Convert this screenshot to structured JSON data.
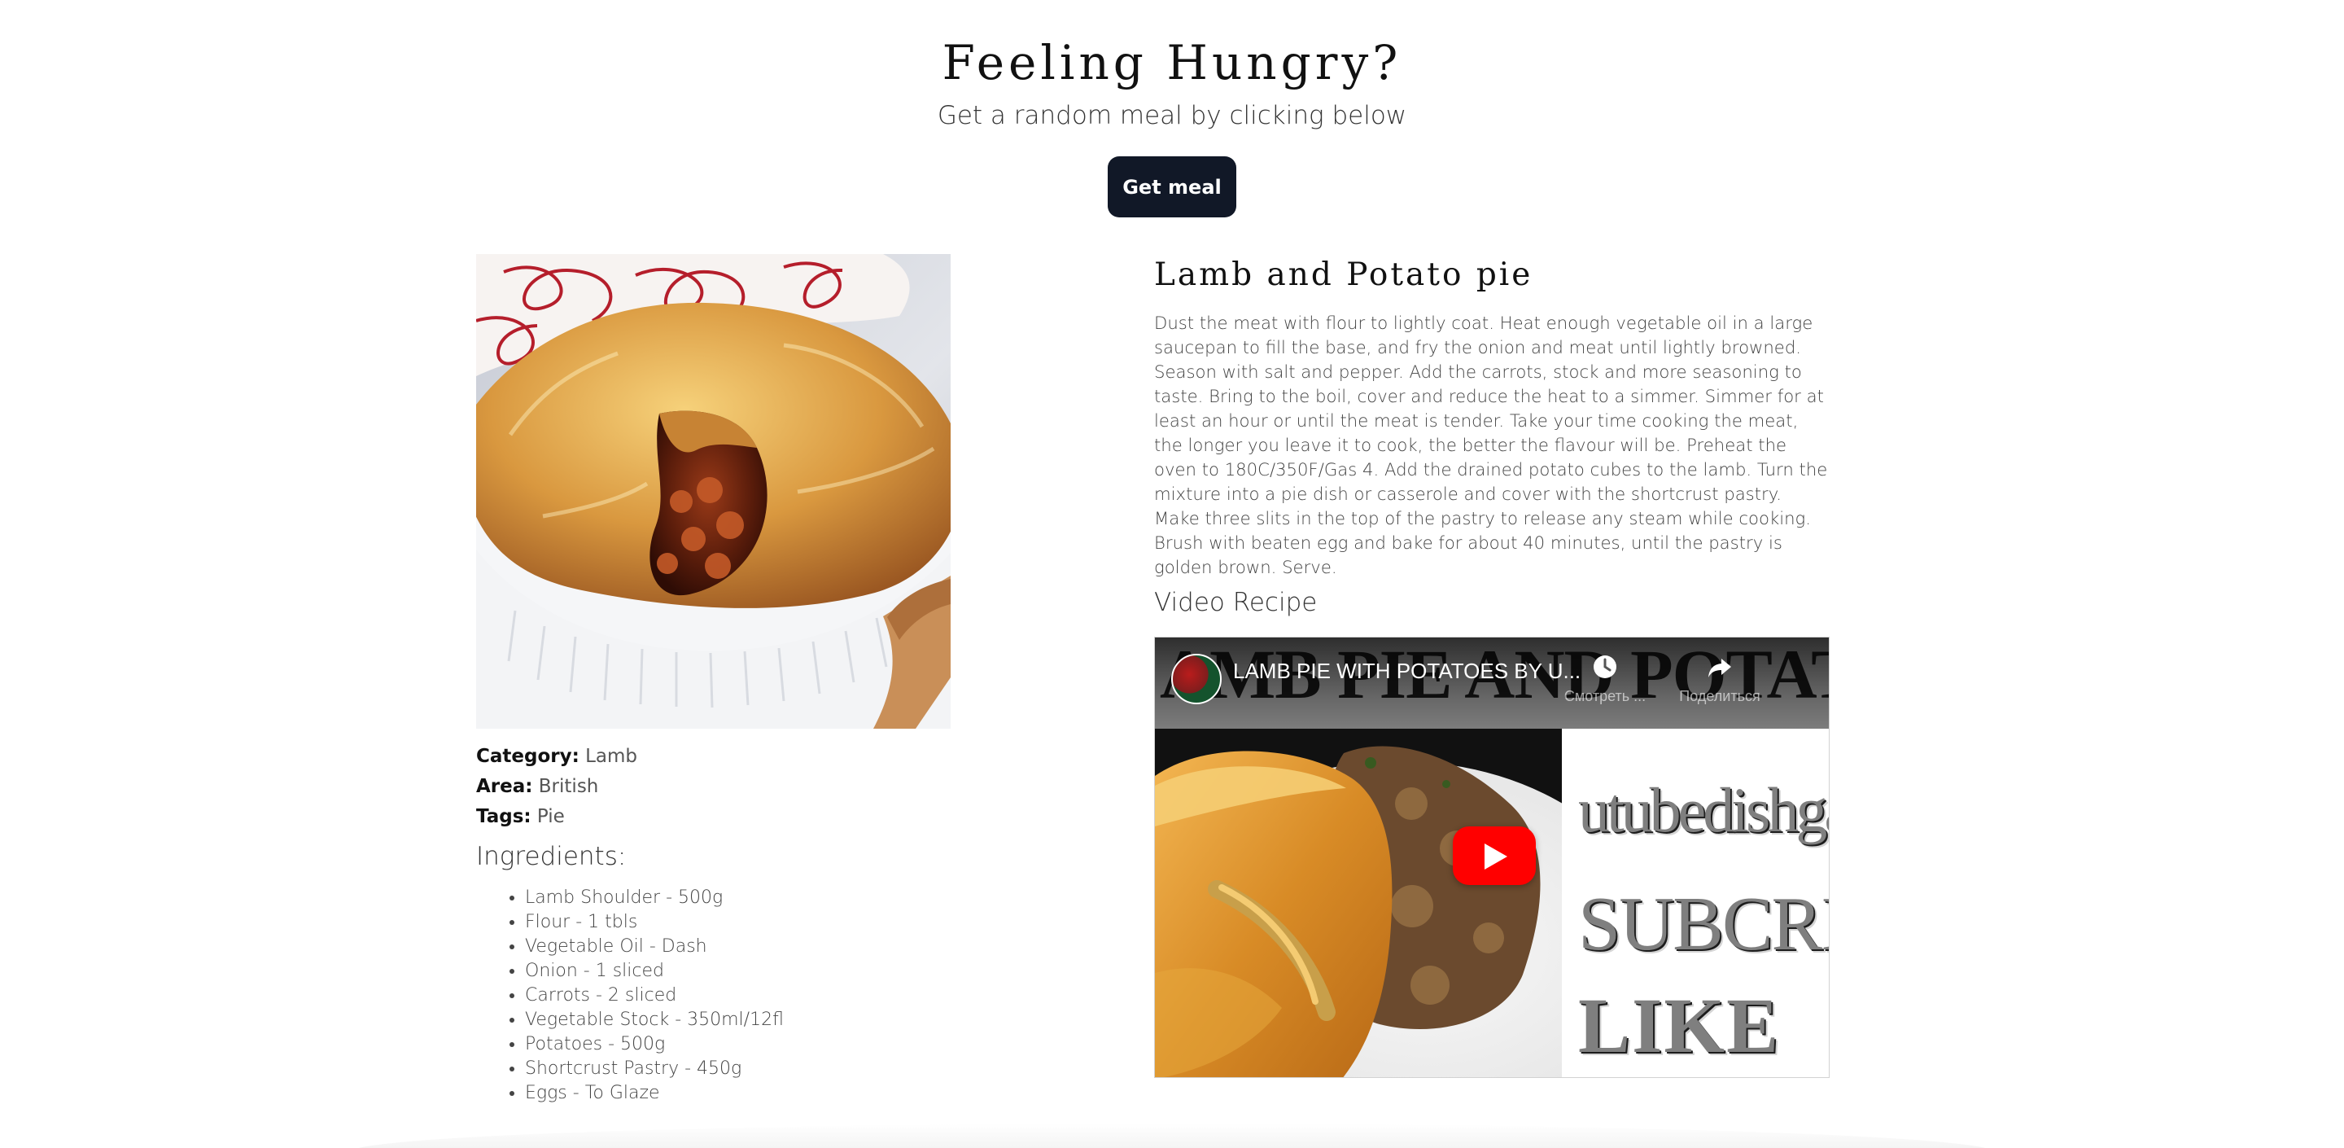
{
  "hero": {
    "title": "Feeling Hungry?",
    "subtitle": "Get a random meal by clicking below",
    "button_label": "Get meal"
  },
  "meal": {
    "title": "Lamb and Potato pie",
    "category_label": "Category:",
    "category": "Lamb",
    "area_label": "Area:",
    "area": "British",
    "tags_label": "Tags:",
    "tags": "Pie",
    "ingredients_heading": "Ingredients:",
    "ingredients": [
      "Lamb Shoulder - 500g",
      "Flour - 1 tbls",
      "Vegetable Oil - Dash",
      "Onion - 1 sliced",
      "Carrots - 2 sliced",
      "Vegetable Stock - 350ml/12fl",
      "Potatoes - 500g",
      "Shortcrust Pastry - 450g",
      "Eggs - To Glaze"
    ],
    "instructions": "Dust the meat with flour to lightly coat. Heat enough vegetable oil in a large saucepan to fill the base, and fry the onion and meat until lightly browned. Season with salt and pepper. Add the carrots, stock and more seasoning to taste. Bring to the boil, cover and reduce the heat to a simmer. Simmer for at least an hour or until the meat is tender. Take your time cooking the meat, the longer you leave it to cook, the better the flavour will be. Preheat the oven to 180C/350F/Gas 4. Add the drained potato cubes to the lamb. Turn the mixture into a pie dish or casserole and cover with the shortcrust pastry. Make three slits in the top of the pastry to release any steam while cooking. Brush with beaten egg and bake for about 40 minutes, until the pastry is golden brown. Serve.",
    "video_heading": "Video Recipe"
  },
  "video": {
    "background_title": "AMB PIE AND POTATOE",
    "title": "LAMB PIE WITH POTATOES BY U...",
    "watch_later_label": "Смотреть ...",
    "share_label": "Поделиться",
    "side_text_1": "utubedishgagi",
    "side_text_2": "SUBCRIB",
    "side_text_3": "LIKE",
    "play_icon": "play-icon",
    "watch_later_icon": "clock-icon",
    "share_icon": "share-icon"
  },
  "colors": {
    "button": "#111827",
    "youtube_red": "#ff0000",
    "text": "#444444"
  }
}
